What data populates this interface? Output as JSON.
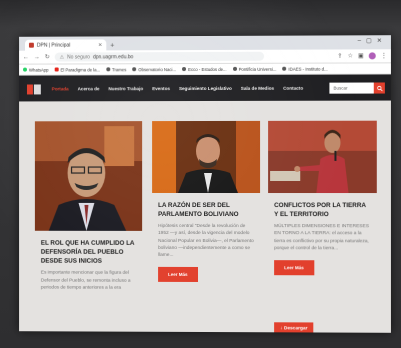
{
  "browser": {
    "tab_title": "DPN | Principal",
    "url_security": "No seguro",
    "url_text": "dpn.uagrm.edu.bo",
    "bookmarks": [
      "WhatsApp",
      "El Paradigma de la...",
      "Trames",
      "Observatorio Naci...",
      "Ecco - Estudos de...",
      "Pontificia Universi...",
      "IDAES - Instituto d..."
    ]
  },
  "site": {
    "menu": [
      "Portada",
      "Acerca de",
      "Nuestro Trabajo",
      "Eventos",
      "Seguimiento Legislativo",
      "Sala de Medios",
      "Contacto"
    ],
    "search_placeholder": "Buscar",
    "accent": "#e2402d"
  },
  "cards": [
    {
      "title": "El rol que ha cumplido la Defensoría del Pueblo desde sus inicios",
      "body": "Es importante mencionar que la figura del Defensor del Pueblo, se remonta incluso a periodos de tiempo anteriores a la era",
      "button": ""
    },
    {
      "title": "La razón de ser del Parlamento Boliviano",
      "body": "Hipótesis central \"Desde la revolución de 1952 —y así, desde la vigencia del modelo Nacional Popular en Bolivia—, el Parlamento boliviano —independientemente a como se llame...",
      "button": "Leer Más"
    },
    {
      "title": "Conflictos por la tierra y el territorio",
      "body": "MÚLTIPLES DIMENSIONES E INTERESES EN TORNO A LA TIERRA: el acceso a la tierra es conflictivo por su propia naturaleza, porque el control de la tierra...",
      "button": "Leer Más"
    }
  ],
  "download_label": "Descargar"
}
